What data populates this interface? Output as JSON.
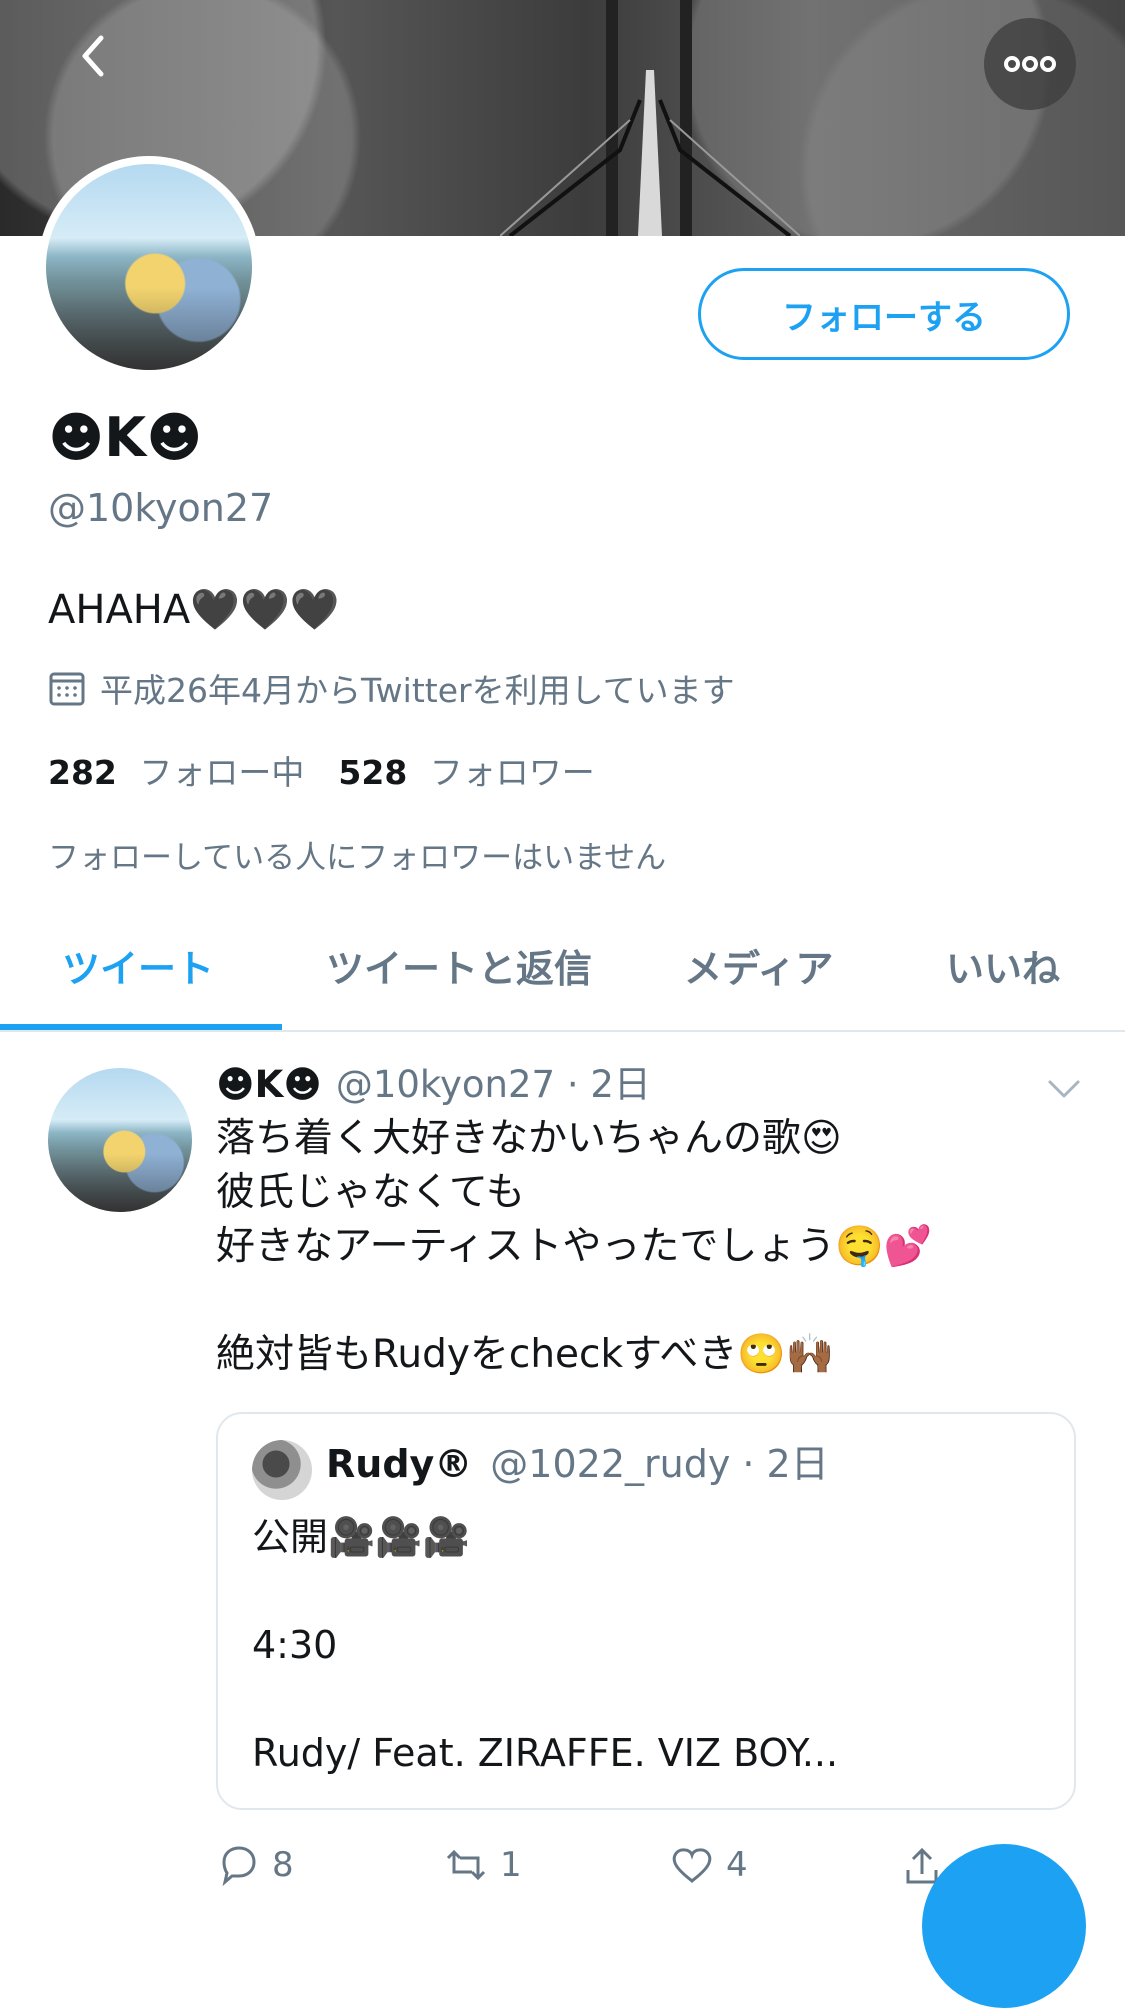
{
  "header": {
    "back_icon": "back-arrow-icon",
    "more_icon": "more-options-icon"
  },
  "profile": {
    "follow_button": "フォローする",
    "display_name": "☻K☻",
    "handle": "@10kyon27",
    "bio": "AHAHA🖤🖤🖤",
    "joined": "平成26年4月からTwitterを利用しています",
    "following_count": "282",
    "following_label": "フォロー中",
    "followers_count": "528",
    "followers_label": "フォロワー",
    "known_followers": "フォローしている人にフォロワーはいません"
  },
  "tabs": [
    {
      "label": "ツイート"
    },
    {
      "label": "ツイートと返信"
    },
    {
      "label": "メディア"
    },
    {
      "label": "いいね"
    }
  ],
  "tweet": {
    "author": "☻K☻",
    "handle_date": "@10kyon27 · 2日",
    "text": "落ち着く大好きなかいちゃんの歌😍\n彼氏じゃなくても\n好きなアーティストやったでしょう🤤💕\n\n絶対皆もRudyをcheckすべき🙄🙌🏾",
    "quoted": {
      "author": "Rudy®",
      "handle_date": "@1022_rudy · 2日",
      "text": "公開🎥🎥🎥\n\n4:30\n\nRudy/ Feat. ZIRAFFE. VIZ BOY..."
    },
    "actions": {
      "reply_count": "8",
      "retweet_count": "1",
      "like_count": "4"
    }
  },
  "colors": {
    "accent": "#1da1f2",
    "secondary_text": "#657786",
    "divider": "#e1e8ed"
  }
}
